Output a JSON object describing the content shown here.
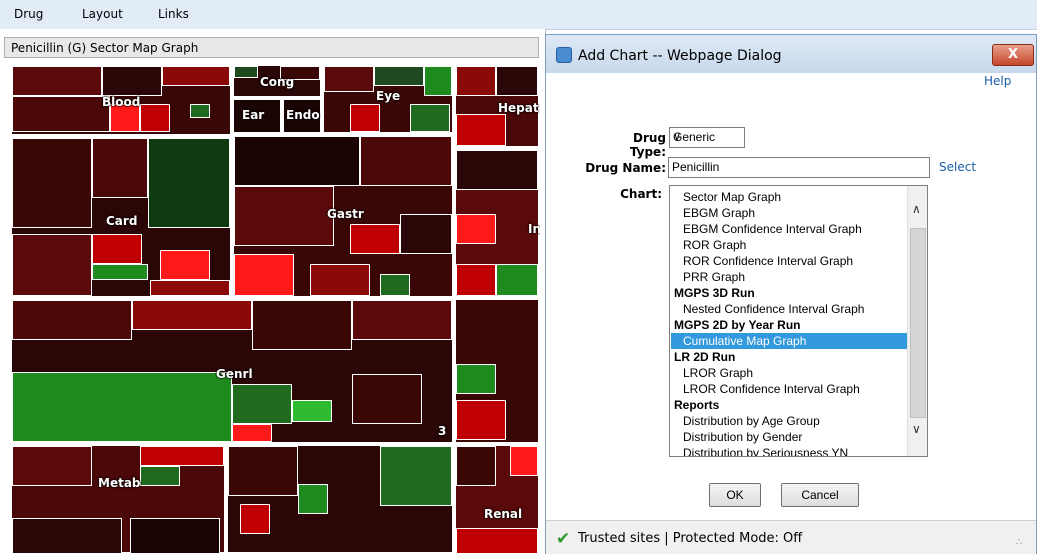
{
  "menubar": {
    "items": [
      "Drug",
      "Layout",
      "Links"
    ]
  },
  "panel": {
    "title": "Penicillin (G) Sector Map Graph"
  },
  "treemap": {
    "labels": [
      "Blood",
      "Cong",
      "Eye",
      "Ear",
      "Endo",
      "Hepat",
      "Card",
      "Gastr",
      "In",
      "Genrl",
      "3",
      "Metab",
      "Renal"
    ],
    "colors": {
      "dark": "#2a0606",
      "red": "#c00000",
      "bright_red": "#ff1a1a",
      "green": "#1f8a1f",
      "dark_green": "#0f3a0f",
      "maroon": "#5a0a0a"
    }
  },
  "dialog": {
    "title": "Add Chart -- Webpage Dialog",
    "close_label": "X",
    "help_label": "Help",
    "drug_type_label": "Drug Type:",
    "drug_type_value": "Generic",
    "drug_name_label": "Drug Name:",
    "drug_name_value": "Penicillin",
    "select_link": "Select",
    "chart_label": "Chart:",
    "chart_options": [
      {
        "text": "Sector Map Graph",
        "kind": "opt"
      },
      {
        "text": "EBGM Graph",
        "kind": "opt"
      },
      {
        "text": "EBGM Confidence Interval Graph",
        "kind": "opt"
      },
      {
        "text": "ROR Graph",
        "kind": "opt"
      },
      {
        "text": "ROR Confidence Interval Graph",
        "kind": "opt"
      },
      {
        "text": "PRR Graph",
        "kind": "opt"
      },
      {
        "text": "MGPS 3D Run",
        "kind": "group"
      },
      {
        "text": "Nested Confidence Interval Graph",
        "kind": "opt"
      },
      {
        "text": "MGPS 2D by Year Run",
        "kind": "group"
      },
      {
        "text": "Cumulative Map Graph",
        "kind": "selected"
      },
      {
        "text": "LR 2D Run",
        "kind": "group"
      },
      {
        "text": "LROR Graph",
        "kind": "opt"
      },
      {
        "text": "LROR Confidence Interval Graph",
        "kind": "opt"
      },
      {
        "text": "Reports",
        "kind": "group"
      },
      {
        "text": "Distribution by Age Group",
        "kind": "opt"
      },
      {
        "text": "Distribution by Gender",
        "kind": "opt"
      },
      {
        "text": "Distribution by Seriousness YN",
        "kind": "opt"
      }
    ],
    "ok_label": "OK",
    "cancel_label": "Cancel",
    "status_text": "Trusted sites | Protected Mode: Off"
  }
}
